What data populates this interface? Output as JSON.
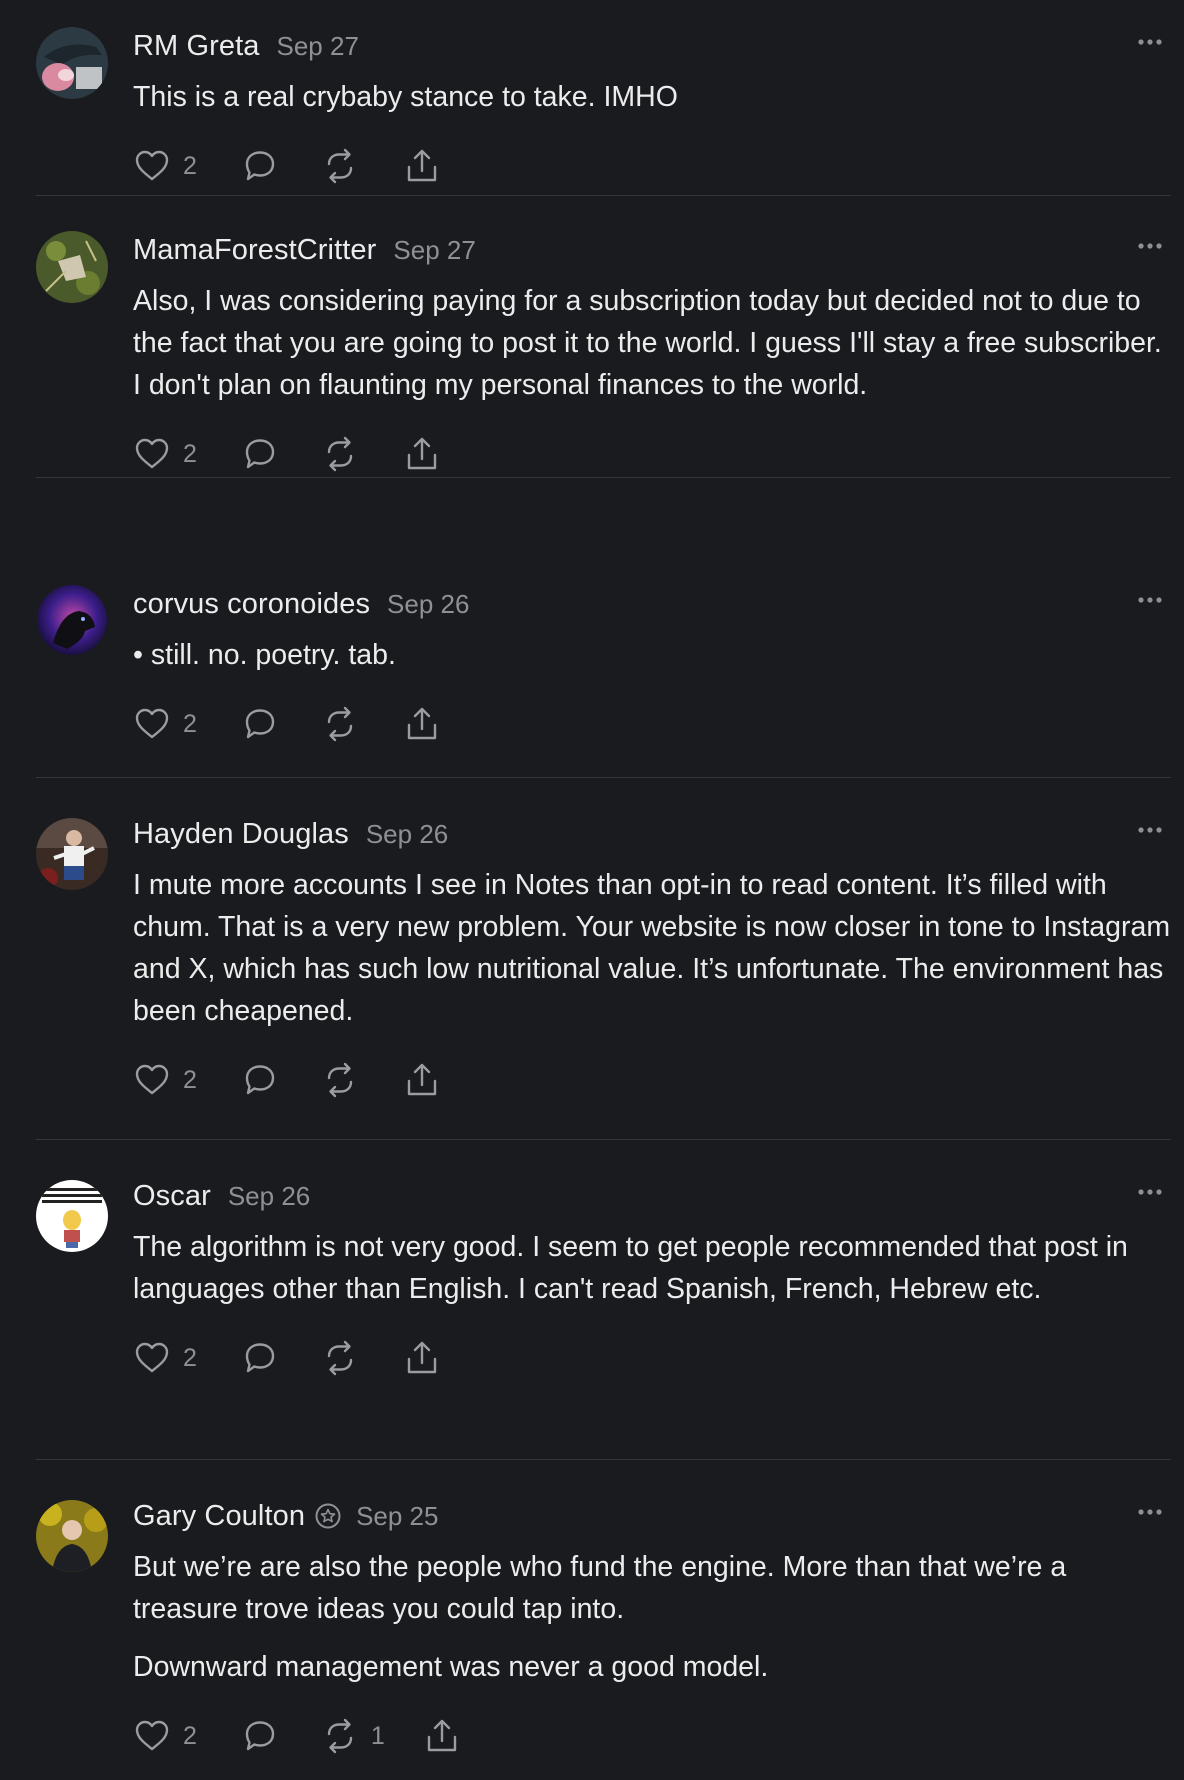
{
  "comments": [
    {
      "author": "RM Greta",
      "date": "Sep 27",
      "paragraphs": [
        "This is a real crybaby stance to take. IMHO"
      ],
      "likes": "2",
      "restacks": ""
    },
    {
      "author": "MamaForestCritter",
      "date": "Sep 27",
      "paragraphs": [
        "Also, I was considering paying for a subscription today but decided not to due to the fact that you are going to post it to the world. I guess I'll stay a free subscriber. I don't plan on flaunting my personal finances to the world."
      ],
      "likes": "2",
      "restacks": ""
    },
    {
      "author": "corvus coronoides",
      "date": "Sep 26",
      "paragraphs": [
        "• still. no. poetry. tab."
      ],
      "likes": "2",
      "restacks": ""
    },
    {
      "author": "Hayden Douglas",
      "date": "Sep 26",
      "paragraphs": [
        "I mute more accounts I see in Notes than opt-in to read content. It’s filled with chum. That is a very new problem. Your website is now closer in tone to Instagram and X, which has such low nutritional value. It’s unfortunate. The environment has been cheapened."
      ],
      "likes": "2",
      "restacks": ""
    },
    {
      "author": "Oscar",
      "date": "Sep 26",
      "paragraphs": [
        "The algorithm is not very good. I seem to get people recommended that post in languages other than English. I can't read Spanish, French, Hebrew etc."
      ],
      "likes": "2",
      "restacks": ""
    },
    {
      "author": "Gary Coulton",
      "date": "Sep 25",
      "verified": true,
      "paragraphs": [
        "But we’re are also the people who fund the engine. More than that we’re a treasure trove ideas you could tap into.",
        "Downward management was never a good model."
      ],
      "likes": "2",
      "restacks": "1"
    }
  ],
  "icons": {
    "like": "heart-icon",
    "reply": "comment-bubble-icon",
    "restack": "restack-icon",
    "share": "share-icon",
    "more": "more-dots-icon",
    "verified": "badge-icon"
  },
  "colors": {
    "background": "#1a1b1e",
    "text": "#ececec",
    "muted": "#8e9096",
    "divider": "#34363b"
  }
}
